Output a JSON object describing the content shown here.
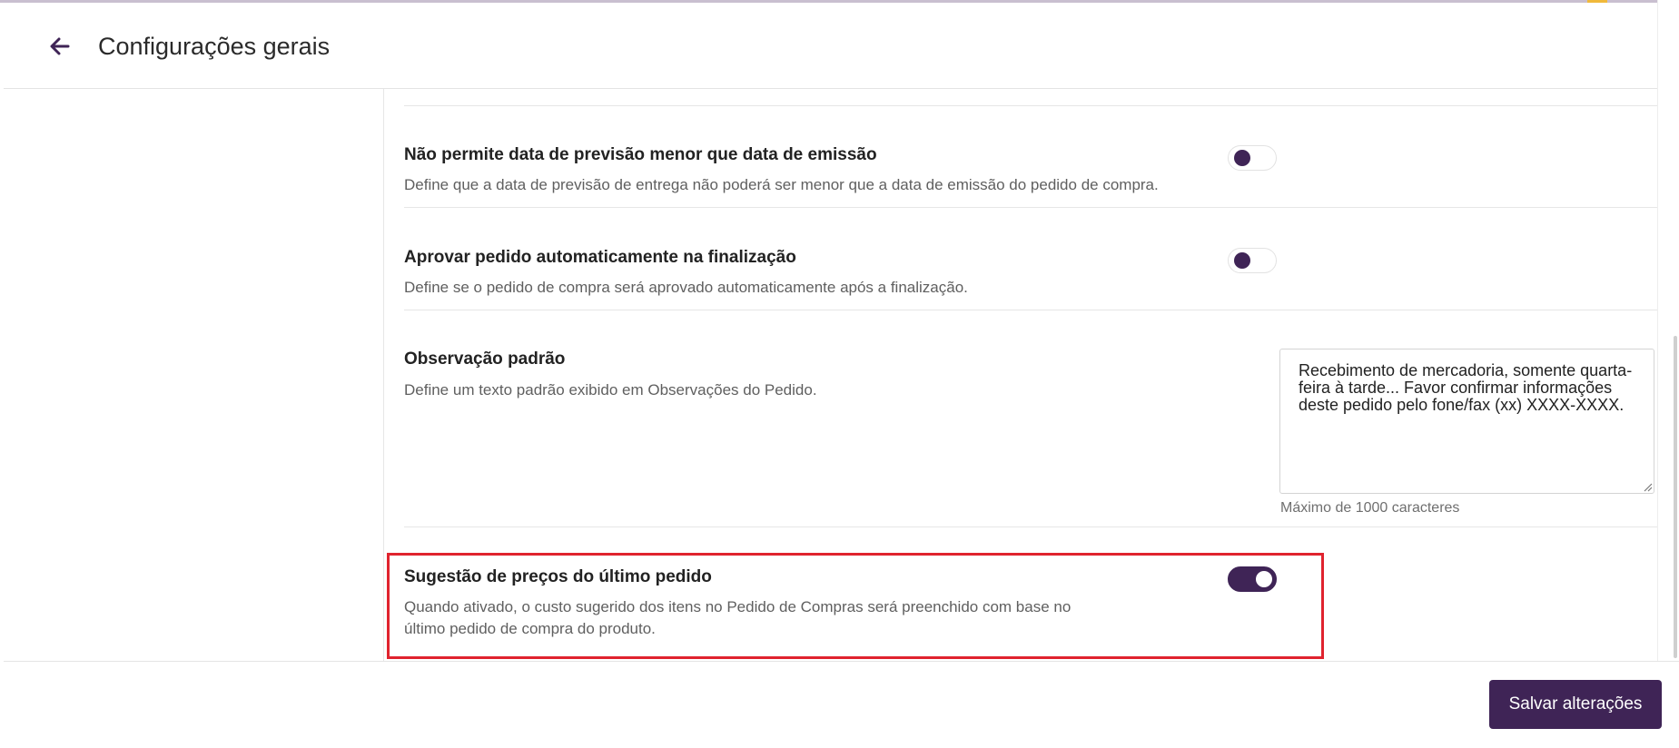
{
  "header": {
    "title": "Configurações gerais",
    "back_icon": "arrow-left-icon"
  },
  "colors": {
    "primary": "#3f2456",
    "highlight": "#e0232e",
    "description": "#5f5f5f"
  },
  "settings": [
    {
      "title": "Não permite data de previsão menor que data de emissão",
      "description": "Define que a data de previsão de entrega não poderá ser menor que a data de emissão do pedido de compra.",
      "enabled": false
    },
    {
      "title": "Aprovar pedido automaticamente na finalização",
      "description": "Define se o pedido de compra será aprovado automaticamente após a finalização.",
      "enabled": false
    },
    {
      "title": "Observação padrão",
      "description": "Define um texto padrão exibido em Observações do Pedido.",
      "value": "Recebimento de mercadoria, somente quarta-feira à tarde... Favor confirmar informações deste pedido pelo fone/fax (xx) XXXX-XXXX.",
      "hint": "Máximo de 1000 caracteres"
    },
    {
      "title": "Sugestão de preços do último pedido",
      "description_line1": "Quando ativado, o custo sugerido dos itens no Pedido de Compras será preenchido com base no",
      "description_line2": "último pedido de compra do produto.",
      "enabled": true
    }
  ],
  "footer": {
    "save_label": "Salvar alterações"
  }
}
